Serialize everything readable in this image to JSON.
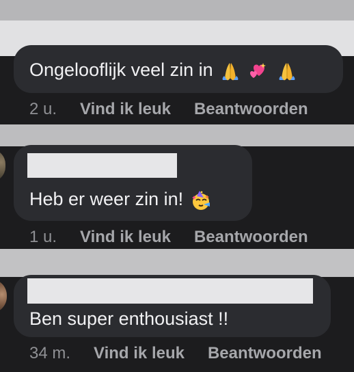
{
  "comments": [
    {
      "text": "Ongelooflijk veel zin in",
      "emojis": [
        "folded-hands-icon",
        "two-hearts-icon",
        "folded-hands-icon"
      ],
      "time": "2 u.",
      "like_label": "Vind ik leuk",
      "reply_label": "Beantwoorden"
    },
    {
      "text": "Heb er weer zin in!",
      "emojis": [
        "partying-face-icon"
      ],
      "time": "1 u.",
      "like_label": "Vind ik leuk",
      "reply_label": "Beantwoorden"
    },
    {
      "text": "Ben super enthousiast !!",
      "emojis": [],
      "time": "34 m.",
      "like_label": "Vind ik leuk",
      "reply_label": "Beantwoorden"
    }
  ]
}
